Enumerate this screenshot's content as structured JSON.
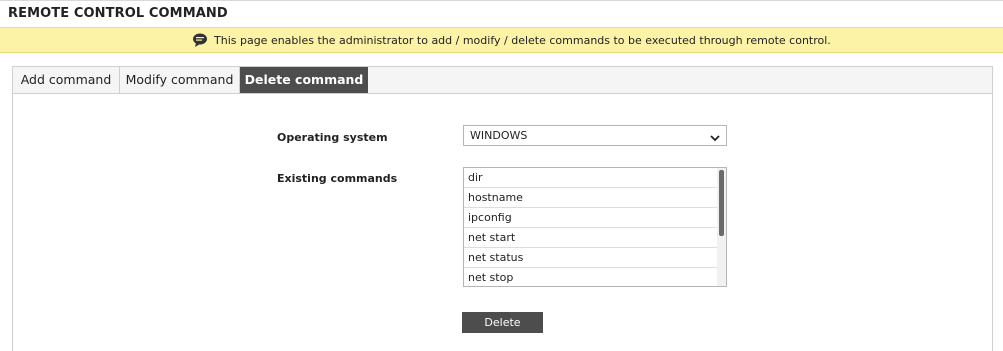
{
  "header": {
    "title": "REMOTE CONTROL COMMAND"
  },
  "info": {
    "icon": "chat-bubble-icon",
    "text": "This page enables the administrator to add / modify / delete commands to be executed through remote control."
  },
  "tabs": [
    {
      "label": "Add command"
    },
    {
      "label": "Modify command"
    },
    {
      "label": "Delete command"
    }
  ],
  "active_tab": "Delete command",
  "form": {
    "os_label": "Operating system",
    "os_value": "WINDOWS",
    "commands_label": "Existing commands",
    "commands": [
      "dir",
      "hostname",
      "ipconfig",
      "net start",
      "net status",
      "net stop"
    ],
    "delete_label": "Delete"
  },
  "colors": {
    "accent": "#4d4d4d",
    "info_bg": "#fcf3a6"
  }
}
